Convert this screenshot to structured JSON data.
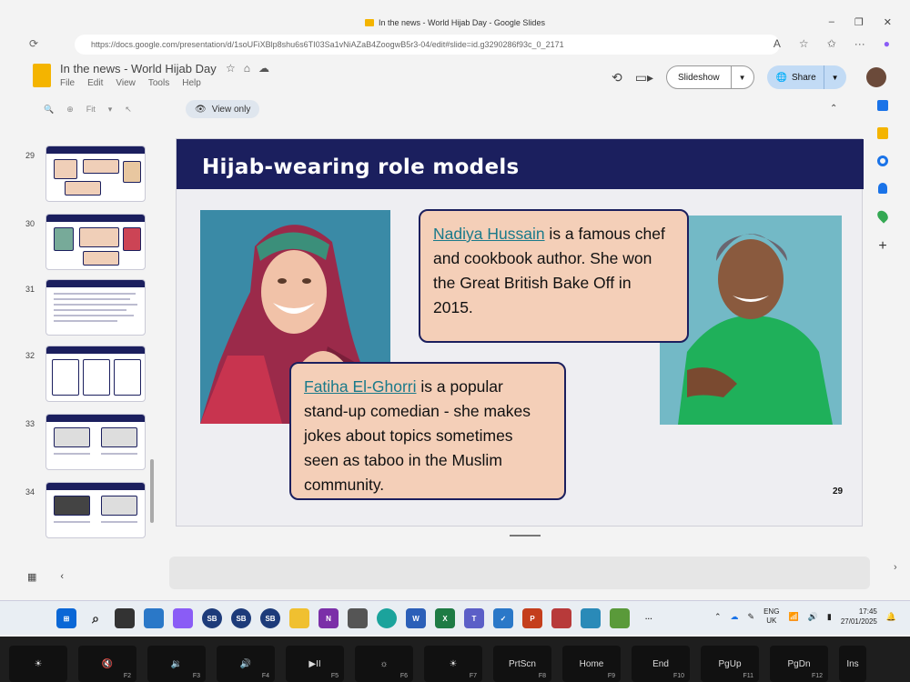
{
  "window": {
    "title": "In the news - World Hijab Day - Google Slides",
    "controls": [
      "–",
      "❐",
      "✕"
    ]
  },
  "browser": {
    "url": "https://docs.google.com/presentation/d/1soUFiXBlp8shu6s6TI03Sa1vNiAZaB4ZoogwB5r3-04/edit#slide=id.g3290286f93c_0_2171"
  },
  "docs": {
    "title": "In the news - World Hijab Day",
    "menu": [
      "File",
      "Edit",
      "View",
      "Tools",
      "Help"
    ],
    "slideshow_label": "Slideshow",
    "share_label": "Share",
    "view_only_label": "View only",
    "zoom_label": "Fit"
  },
  "filmstrip": {
    "slides": [
      {
        "num": "29"
      },
      {
        "num": "30"
      },
      {
        "num": "31"
      },
      {
        "num": "32"
      },
      {
        "num": "33"
      },
      {
        "num": "34"
      }
    ]
  },
  "slide": {
    "title": "Hijab-wearing role models",
    "box1": {
      "name": "Nadiya Hussain",
      "text": " is a famous chef and cookbook author. She won the Great British Bake Off in 2015."
    },
    "box2": {
      "name": "Fatiha El-Ghorri",
      "text": " is a popular stand-up comedian - she makes jokes about topics sometimes seen as taboo in the Muslim community."
    },
    "page_number": "29"
  },
  "taskbar": {
    "lang": "ENG",
    "region": "UK",
    "time": "17:45",
    "date": "27/01/2025"
  },
  "keyboard": {
    "keys": [
      {
        "label": "☀",
        "fn": ""
      },
      {
        "label": "🔇",
        "fn": "F2"
      },
      {
        "label": "🔉",
        "fn": "F3"
      },
      {
        "label": "🔊",
        "fn": "F4"
      },
      {
        "label": "▶II",
        "fn": "F5"
      },
      {
        "label": "☼",
        "fn": "F6"
      },
      {
        "label": "☀",
        "fn": "F7"
      },
      {
        "label": "PrtScn",
        "fn": "F8"
      },
      {
        "label": "Home",
        "fn": "F9"
      },
      {
        "label": "End",
        "fn": "F10"
      },
      {
        "label": "PgUp",
        "fn": "F11"
      },
      {
        "label": "PgDn",
        "fn": "F12"
      },
      {
        "label": "Ins",
        "fn": ""
      }
    ]
  },
  "colors": {
    "slide_header": "#1b1f5e",
    "box_fill": "#f4cfb8",
    "link": "#1a7a8a",
    "share_button": "#c2dbf5"
  }
}
